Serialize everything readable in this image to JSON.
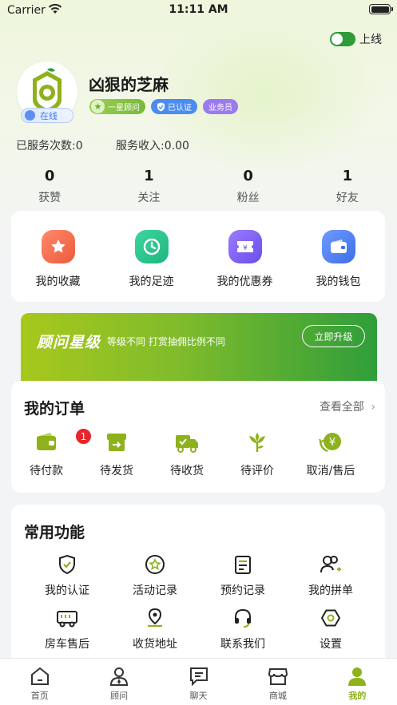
{
  "status_bar": {
    "carrier": "Carrier",
    "time": "11:11 AM"
  },
  "online_toggle": {
    "label": "上线",
    "on": true
  },
  "profile": {
    "name": "凶狠的芝麻",
    "status_badge": "在线",
    "tags": {
      "level": "一星顾问",
      "verified": "已认证",
      "role": "业务员"
    },
    "service_count_label": "已服务次数:0",
    "service_income_label": "服务收入:0.00"
  },
  "counts": [
    {
      "value": "0",
      "label": "获赞"
    },
    {
      "value": "1",
      "label": "关注"
    },
    {
      "value": "0",
      "label": "粉丝"
    },
    {
      "value": "1",
      "label": "好友"
    }
  ],
  "quick_links": [
    {
      "label": "我的收藏",
      "icon": "star-icon",
      "color": "#f06a4a"
    },
    {
      "label": "我的足迹",
      "icon": "clock-icon",
      "color": "#26c28c"
    },
    {
      "label": "我的优惠券",
      "icon": "coupon-icon",
      "color": "#7b5cf0"
    },
    {
      "label": "我的钱包",
      "icon": "wallet-icon",
      "color": "#4c7ef0"
    }
  ],
  "level_banner": {
    "title": "顾问星级",
    "description": "等级不同  打赏抽佣比例不同",
    "button": "立即升级"
  },
  "orders": {
    "title": "我的订单",
    "view_all": "查看全部",
    "items": [
      {
        "label": "待付款",
        "icon": "wallet-icon",
        "badge": "1"
      },
      {
        "label": "待发货",
        "icon": "box-icon"
      },
      {
        "label": "待收货",
        "icon": "truck-icon"
      },
      {
        "label": "待评价",
        "icon": "flower-icon"
      },
      {
        "label": "取消/售后",
        "icon": "refund-icon"
      }
    ]
  },
  "functions": {
    "title": "常用功能",
    "items": [
      {
        "label": "我的认证",
        "icon": "shield-check-icon"
      },
      {
        "label": "活动记录",
        "icon": "star-circle-icon"
      },
      {
        "label": "预约记录",
        "icon": "document-icon"
      },
      {
        "label": "我的拼单",
        "icon": "group-add-icon"
      },
      {
        "label": "房车售后",
        "icon": "rv-icon"
      },
      {
        "label": "收货地址",
        "icon": "location-icon"
      },
      {
        "label": "联系我们",
        "icon": "headset-icon"
      },
      {
        "label": "设置",
        "icon": "settings-icon"
      }
    ]
  },
  "tabbar": [
    {
      "label": "首页",
      "icon": "home-icon"
    },
    {
      "label": "顾问",
      "icon": "advisor-icon"
    },
    {
      "label": "聊天",
      "icon": "chat-icon"
    },
    {
      "label": "商城",
      "icon": "store-icon"
    },
    {
      "label": "我的",
      "icon": "profile-icon",
      "active": true
    }
  ],
  "colors": {
    "accent": "#8db21b",
    "switch_on": "#2e9a3a",
    "badge_red": "#e6262c"
  }
}
